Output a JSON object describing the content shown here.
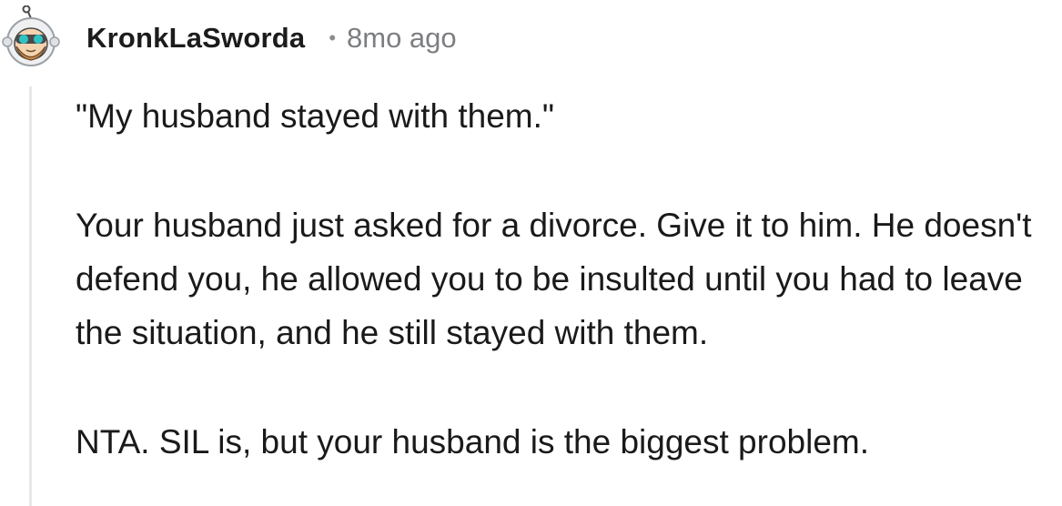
{
  "comment": {
    "author": "KronkLaSworda",
    "separator": "•",
    "timestamp": "8mo ago",
    "avatar_icon": "reddit-snoo-astronaut-avatar-icon",
    "paragraphs": [
      "\"My husband stayed with them.\"",
      "Your husband just asked for a divorce. Give it to him. He doesn't defend you, he allowed you to be insulted until you had to leave the situation, and he still stayed with them.",
      "NTA. SIL is, but your husband is the biggest problem."
    ]
  },
  "colors": {
    "text": "#1a1a1b",
    "meta": "#7c7e81",
    "thread_line": "#e7e8ea",
    "avatar_teal": "#2ec4c4",
    "avatar_beard": "#c9884a"
  }
}
